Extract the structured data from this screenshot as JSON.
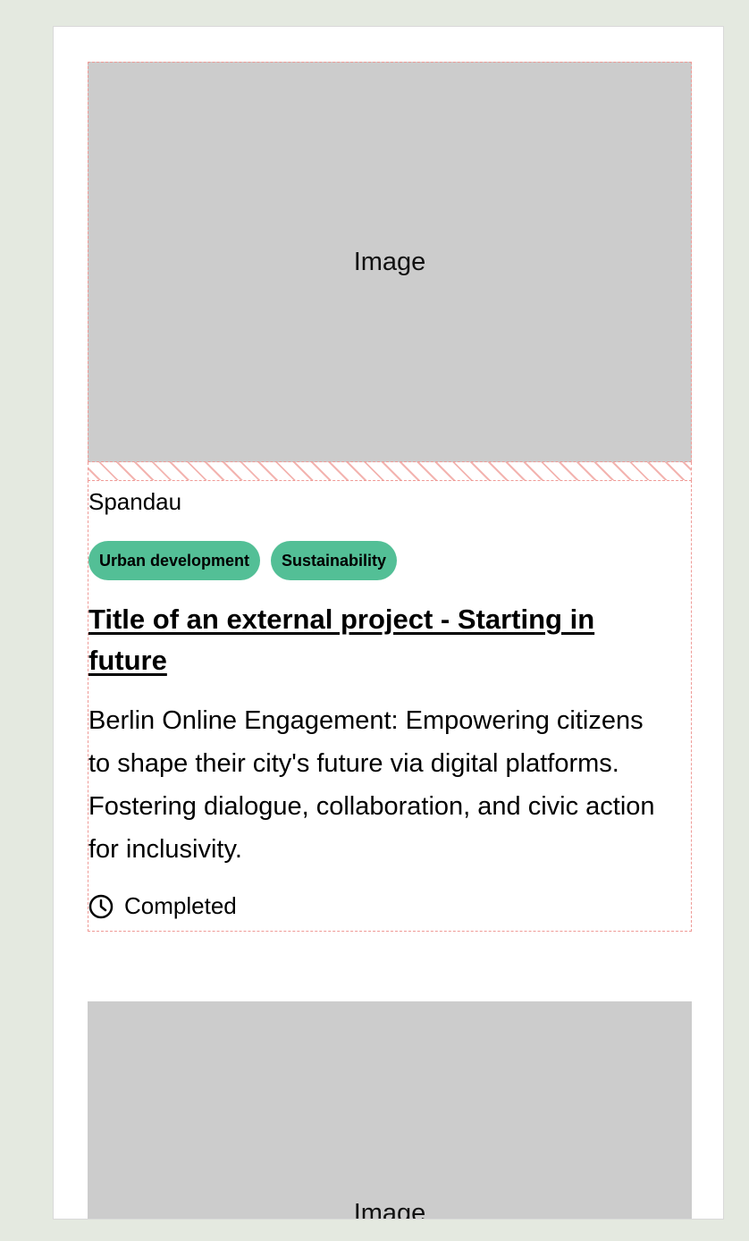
{
  "cards": [
    {
      "image_label": "Image",
      "district": "Spandau",
      "tags": [
        "Urban development",
        "Sustainability"
      ],
      "title": "Title of an external project - Starting in future",
      "description": "Berlin Online Engagement: Empowering citizens to shape their city's future via digital platforms. Fostering dialogue, collaboration, and civic action for inclusivity.",
      "status": "Completed",
      "status_icon": "clock-icon"
    },
    {
      "image_label": "Image"
    }
  ],
  "colors": {
    "page_background": "#e4e9e0",
    "panel_background": "#ffffff",
    "image_placeholder": "#cccccc",
    "tag_background": "#53bf96",
    "debug_outline": "#ef9a96"
  }
}
